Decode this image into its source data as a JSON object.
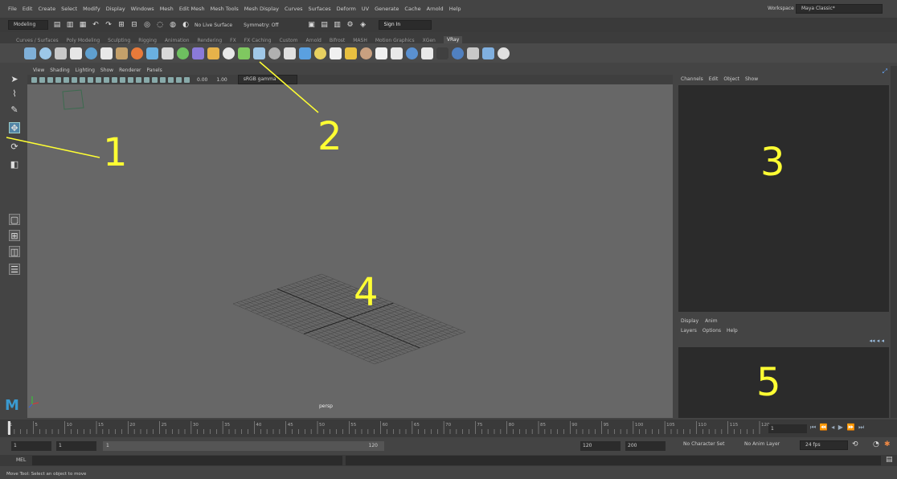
{
  "menubar": [
    "File",
    "Edit",
    "Create",
    "Select",
    "Modify",
    "Display",
    "Windows",
    "Mesh",
    "Edit Mesh",
    "Mesh Tools",
    "Mesh Display",
    "Curves",
    "Surfaces",
    "Deform",
    "UV",
    "Generate",
    "Cache",
    "Arnold",
    "Help"
  ],
  "workspace": {
    "label": "Workspace :",
    "value": "Maya Classic*"
  },
  "statusline": {
    "mode": "Modeling",
    "live_surface": "No Live Surface",
    "symmetry": "Symmetry: Off",
    "sign_in": "Sign In"
  },
  "shelftabs": [
    "Curves / Surfaces",
    "Poly Modeling",
    "Sculpting",
    "Rigging",
    "Animation",
    "Rendering",
    "FX",
    "FX Caching",
    "Custom",
    "Arnold",
    "Bifrost",
    "MASH",
    "Motion Graphics",
    "XGen",
    "VRay"
  ],
  "viewport": {
    "menu": [
      "View",
      "Shading",
      "Lighting",
      "Show",
      "Renderer",
      "Panels"
    ],
    "exposure": "0.00",
    "gamma": "1.00",
    "colorspace": "sRGB gamma",
    "camera": "persp"
  },
  "channelbox": {
    "menu": [
      "Channels",
      "Edit",
      "Object",
      "Show"
    ]
  },
  "layerpanel": {
    "tabs": [
      "Display",
      "Anim"
    ],
    "menu": [
      "Layers",
      "Options",
      "Help"
    ]
  },
  "timeslider": {
    "ticks": [
      "1",
      "5",
      "10",
      "15",
      "20",
      "25",
      "30",
      "35",
      "40",
      "45",
      "50",
      "55",
      "60",
      "65",
      "70",
      "75",
      "80",
      "85",
      "90",
      "95",
      "100",
      "105",
      "110",
      "115",
      "120"
    ],
    "current": "1"
  },
  "rangebar": {
    "start": "1",
    "start2": "1",
    "slider_start": "1",
    "slider_end": "120",
    "end": "120",
    "end2": "200",
    "character_set": "No Character Set",
    "anim_layer": "No Anim Layer",
    "fps": "24 fps"
  },
  "cmdline": {
    "label": "MEL"
  },
  "helpline": "Move Tool: Select an object to move",
  "annotations": [
    "1",
    "2",
    "3",
    "4",
    "5"
  ],
  "colors": {
    "annotation": "#ffff33",
    "viewport": "#676767",
    "panel_dark": "#2b2b2b"
  }
}
